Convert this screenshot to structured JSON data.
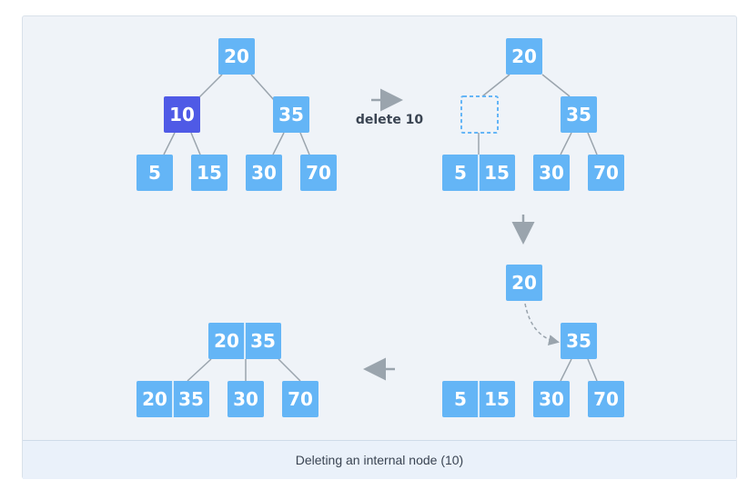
{
  "caption": "Deleting an internal node (10)",
  "step_label": "delete 10",
  "colors": {
    "node": "#64b5f6",
    "highlight": "#4f5ae6",
    "edge": "#9aa4ad",
    "arrow": "#9aa4ad",
    "background": "#eff3f8"
  },
  "trees": [
    {
      "id": "tree-1",
      "root": "20",
      "internal": [
        {
          "key": "10",
          "highlight": true
        },
        {
          "key": "35",
          "highlight": false
        }
      ],
      "leaves": [
        "5",
        "15",
        "30",
        "70"
      ]
    },
    {
      "id": "tree-2",
      "root": "20",
      "internal": [
        {
          "key": "",
          "empty": true
        },
        {
          "key": "35"
        }
      ],
      "leaves": [
        [
          "5",
          "15"
        ],
        "30",
        "70"
      ]
    },
    {
      "id": "tree-3",
      "root": "20",
      "internal": [
        {
          "key": "35"
        }
      ],
      "leaves": [
        [
          "5",
          "15"
        ],
        "30",
        "70"
      ]
    },
    {
      "id": "tree-4",
      "root": [
        "20",
        "35"
      ],
      "leaves": [
        [
          "20",
          "35"
        ],
        "30",
        "70"
      ]
    }
  ]
}
